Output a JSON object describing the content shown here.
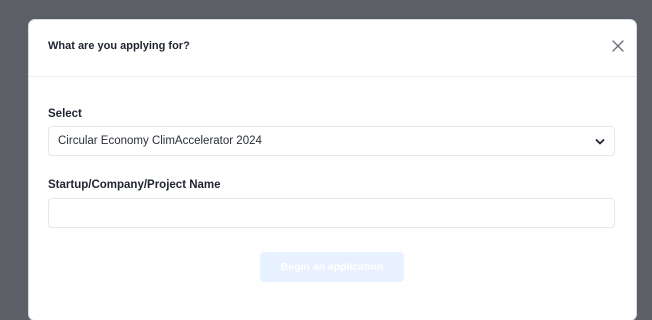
{
  "modal": {
    "title": "What are you applying for?",
    "close_icon": "close-icon"
  },
  "select_field": {
    "label": "Select",
    "value": "Circular Economy ClimAccelerator 2024",
    "icon": "chevron-down-icon"
  },
  "name_field": {
    "label": "Startup/Company/Project Name",
    "value": "",
    "placeholder": ""
  },
  "submit": {
    "label": "Begin an application",
    "disabled": true
  },
  "colors": {
    "backdrop": "#5c5f66",
    "button_disabled_bg": "#e7f1ff",
    "text_primary": "#1f2430"
  }
}
